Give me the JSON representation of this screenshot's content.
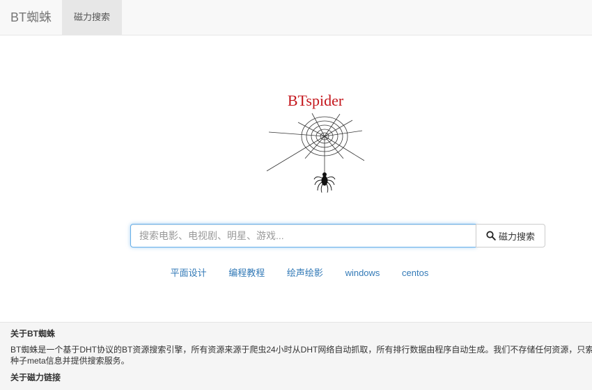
{
  "navbar": {
    "brand": "BT蜘蛛",
    "tab": "磁力搜索"
  },
  "logo": {
    "text": "BTspider"
  },
  "search": {
    "placeholder": "搜索电影、电视剧、明星、游戏...",
    "button_label": "磁力搜索"
  },
  "quick_links": [
    "平面设计",
    "编程教程",
    "绘声绘影",
    "windows",
    "centos"
  ],
  "footer": {
    "about_title": "关于BT蜘蛛",
    "about_text": "BT蜘蛛是一个基于DHT协议的BT资源搜索引擎，所有资源来源于爬虫24小时从DHT网络自动抓取，所有排行数据由程序自动生成。我们不存储任何资源，只索引种子meta信息并提供搜索服务。",
    "magnet_title": "关于磁力链接"
  },
  "colors": {
    "brand_red": "#c4161c",
    "link": "#337ab7",
    "focus": "#66afe9"
  },
  "icons": {
    "search": "search-icon",
    "logo": "spider-web-logo"
  }
}
